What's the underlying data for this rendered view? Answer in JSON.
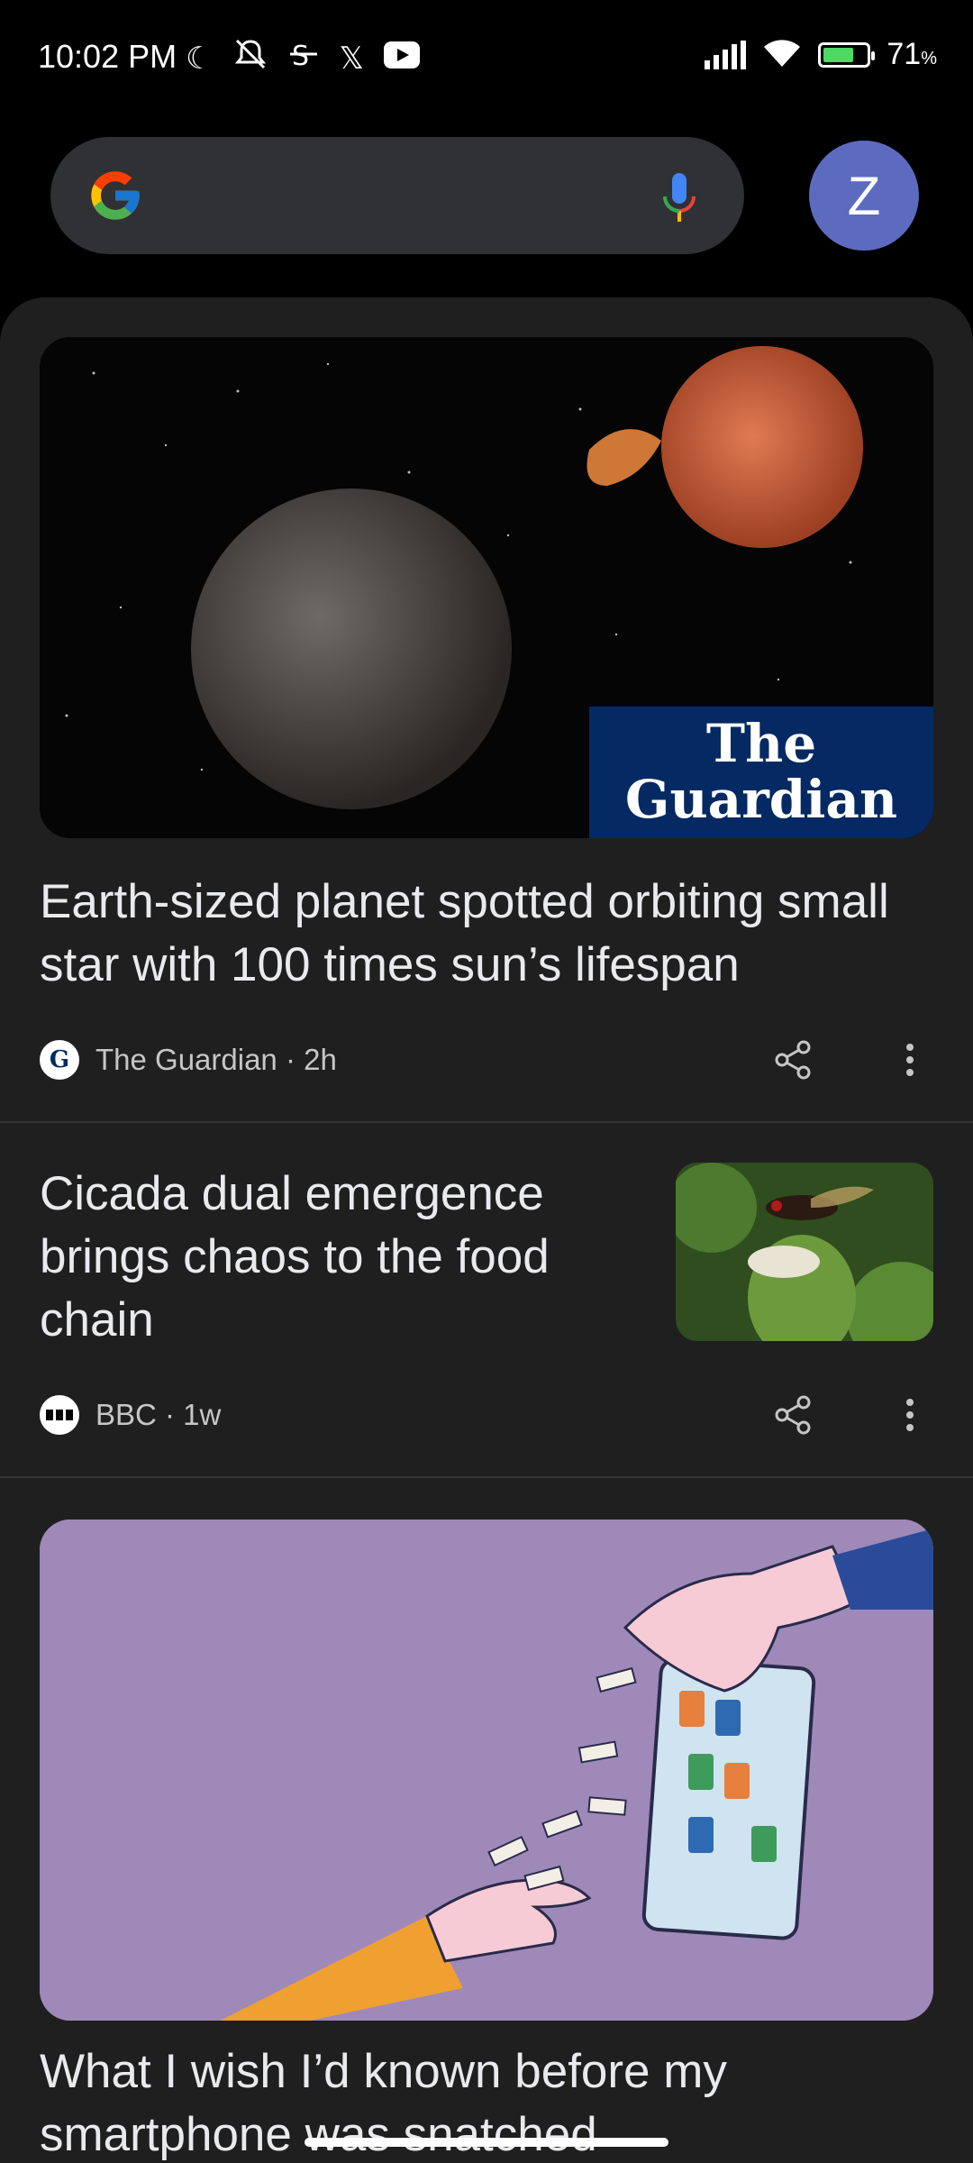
{
  "status_bar": {
    "time": "10:02 PM",
    "battery_percent": "71",
    "battery_unit": "%",
    "battery_level": 0.71,
    "icons": [
      "moon-icon",
      "notifications-off-icon",
      "dnd-icon",
      "x-logo-icon",
      "youtube-icon",
      "signal-icon",
      "wifi-icon",
      "battery-charging-icon"
    ]
  },
  "search": {
    "placeholder": "",
    "avatar_letter": "Z",
    "avatar_color": "#5c6bc0"
  },
  "feed": {
    "articles": [
      {
        "headline": "Earth-sized planet spotted orbiting small star with 100 times sun’s lifespan",
        "source": "The Guardian",
        "age": "2h",
        "source_line": "The Guardian · 2h",
        "image_logo_text": "The Guardian"
      },
      {
        "headline": "Cicada dual emergence brings chaos to the food chain",
        "source": "BBC",
        "age": "1w",
        "source_line": "BBC · 1w"
      },
      {
        "headline": "What I wish I’d known before my smartphone was snatched"
      }
    ]
  },
  "colors": {
    "background": "#000000",
    "feed_background": "#1f1f1f",
    "search_background": "#303134",
    "guardian_blue": "#052962",
    "illustration_purple": "#9e89b9"
  }
}
